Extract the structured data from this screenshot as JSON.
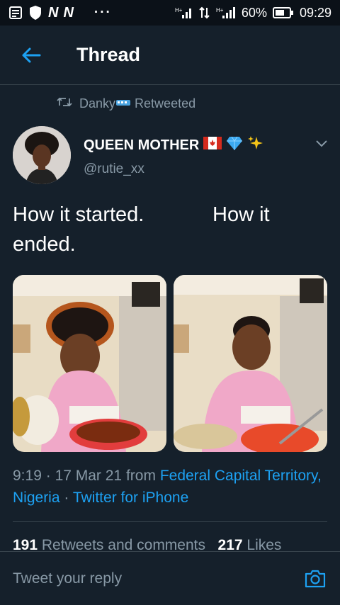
{
  "status_bar": {
    "carrier_1": "N",
    "carrier_2": "N",
    "dots": "···",
    "battery": "60%",
    "time": "09:29"
  },
  "header": {
    "title": "Thread"
  },
  "tweet": {
    "retweeted_by": "Danky",
    "retweeted_label": "Retweeted",
    "author_name": "QUEEN MOTHER",
    "author_handle": "@rutie_xx",
    "text": "How it started.            How it\nended.",
    "time": "9:19",
    "date": "17 Mar 21",
    "from_label": "from",
    "location": "Federal Capital Territory, Nigeria",
    "separator": "·",
    "client": "Twitter for iPhone",
    "retweets_count": "191",
    "retweets_label": "Retweets and comments",
    "likes_count": "217",
    "likes_label": "Likes"
  },
  "reply": {
    "placeholder": "Tweet your reply"
  },
  "colors": {
    "background": "#15202b",
    "accent": "#1da1f2",
    "muted": "#8899a6",
    "border": "#38444d"
  }
}
